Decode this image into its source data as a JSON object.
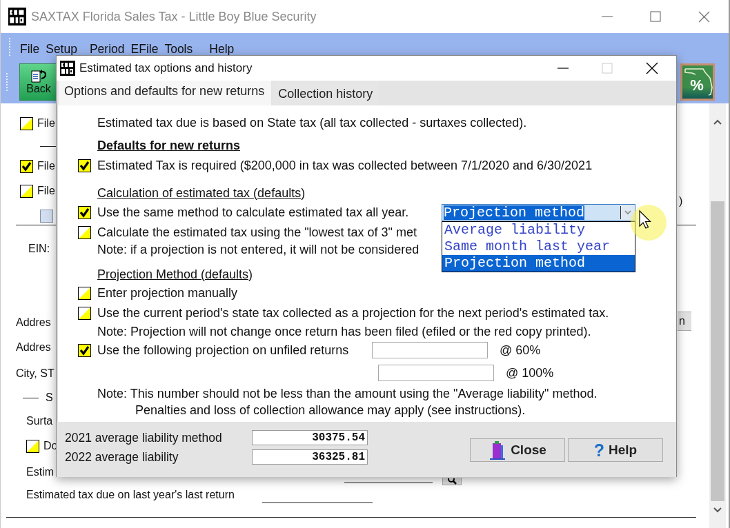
{
  "window": {
    "title": "SAXTAX Florida Sales Tax - Little Boy Blue Security"
  },
  "menu": [
    {
      "label": "File"
    },
    {
      "label": "Setup"
    },
    {
      "label": "Period"
    },
    {
      "label": "EFile"
    },
    {
      "label": "Tools"
    },
    {
      "label": "Help"
    }
  ],
  "toolbar": [
    {
      "kind": "back",
      "label": "Back"
    },
    {
      "kind": "florida",
      "label": "%"
    }
  ],
  "form": {
    "rows": [
      {
        "kind": "checkbox",
        "label": "File",
        "checked": false
      },
      {
        "kind": "rule"
      },
      {
        "kind": "checkbox",
        "label": "File",
        "checked": true
      },
      {
        "kind": "checkbox",
        "label": "File",
        "checked": false
      },
      {
        "kind": "checkbox",
        "checked": false,
        "disabled": true
      },
      {
        "kind": "rule"
      },
      {
        "kind": "text",
        "label": "EIN:"
      },
      {
        "kind": "text",
        "label": "Addres"
      },
      {
        "kind": "text",
        "label": "Addres"
      },
      {
        "kind": "text",
        "label": "City, ST"
      },
      {
        "kind": "section",
        "label": "S"
      },
      {
        "kind": "text",
        "label": "Surta"
      },
      {
        "kind": "checkbox",
        "label": "Do",
        "checked": false
      },
      {
        "kind": "lookup",
        "label": "Estim"
      },
      {
        "kind": "field",
        "label": "Estimated tax due on last year's last return"
      },
      {
        "kind": "rule"
      }
    ],
    "right": [
      {
        "kind": "text",
        "label": ")"
      },
      {
        "kind": "button",
        "label": "n"
      }
    ]
  },
  "dialog": {
    "title": "Estimated tax options and history",
    "tabs": [
      {
        "label": "Options and defaults for new returns",
        "selected": true
      },
      {
        "label": "Collection history",
        "selected": false
      }
    ],
    "rows": [
      {
        "kind": "text",
        "text": "Estimated tax due is based on State tax (all tax collected - surtaxes collected)."
      },
      {
        "kind": "title",
        "text": "Defaults for new returns"
      },
      {
        "kind": "checkbox",
        "text": "Estimated Tax is required ($200,000 in tax was collected between 7/1/2020 and 6/30/2021",
        "checked": true
      },
      {
        "kind": "heading",
        "text": "Calculation of estimated tax (defaults)"
      },
      {
        "kind": "checkbox",
        "text": "Use the same method to calculate estimated tax all year.",
        "checked": true,
        "combo": {
          "value": "Projection method",
          "expanded": true,
          "options": [
            {
              "label": "Average liability",
              "selected": false
            },
            {
              "label": "Same month last year",
              "selected": false
            },
            {
              "label": "Projection method",
              "selected": true
            }
          ]
        }
      },
      {
        "kind": "checkbox",
        "text": "Calculate the estimated tax using the \"lowest tax of 3\" met",
        "checked": false
      },
      {
        "kind": "note",
        "lines": [
          "Note: if a projection is not entered, it will not be considered"
        ]
      },
      {
        "kind": "heading",
        "text": "Projection Method (defaults)"
      },
      {
        "kind": "checkbox",
        "text": "Enter projection manually",
        "checked": false
      },
      {
        "kind": "checkbox",
        "text": "Use the current period's state tax collected as a projection for the next period's estimated tax.",
        "checked": false
      },
      {
        "kind": "note",
        "lines": [
          "Note: Projection will not change once return has been filed (efiled or the red copy printed)."
        ]
      },
      {
        "kind": "checkbox",
        "text": "Use the following projection on unfiled returns",
        "checked": true,
        "inputs": [
          {
            "label": "@ 60%"
          }
        ]
      },
      {
        "kind": "input",
        "inputs": [
          {
            "label": "@ 100%"
          }
        ]
      },
      {
        "kind": "note",
        "lines": [
          "Note: This number should not be less than the amount using the \"Average liability\" method.",
          "Penalties and loss of collection allowance may apply (see instructions)."
        ]
      }
    ],
    "footer": {
      "fields": [
        {
          "label": "2021 average liability method",
          "value": "30375.54"
        },
        {
          "label": "2022 average liability",
          "value": "36325.81"
        }
      ],
      "buttons": [
        {
          "kind": "close",
          "label": "Close"
        },
        {
          "kind": "help",
          "icon": "?",
          "label": "Help"
        }
      ]
    }
  }
}
